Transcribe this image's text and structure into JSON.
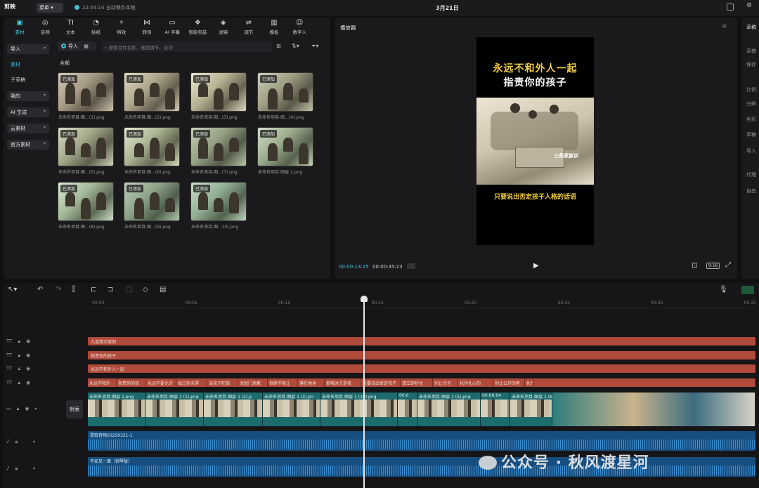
{
  "app": {
    "logo": "剪映",
    "menu": "菜单",
    "save_time": "22:04:14",
    "save_text": "自动保存本地",
    "doc_title": "3月21日"
  },
  "tools": [
    {
      "label": "素材",
      "icon": "media-icon"
    },
    {
      "label": "音频",
      "icon": "audio-icon"
    },
    {
      "label": "文本",
      "icon": "text-icon"
    },
    {
      "label": "贴纸",
      "icon": "sticker-icon"
    },
    {
      "label": "特效",
      "icon": "effects-icon"
    },
    {
      "label": "转场",
      "icon": "transition-icon"
    },
    {
      "label": "AI 字幕",
      "icon": "ai-caption-icon"
    },
    {
      "label": "智能包装",
      "icon": "smart-pack-icon"
    },
    {
      "label": "滤镜",
      "icon": "filter-icon"
    },
    {
      "label": "调节",
      "icon": "adjust-icon"
    },
    {
      "label": "模板",
      "icon": "template-icon"
    },
    {
      "label": "数字人",
      "icon": "avatar-icon"
    }
  ],
  "sidebar": {
    "items": [
      {
        "label": "导入",
        "chevron": true
      },
      {
        "label": "素材",
        "chevron": false
      },
      {
        "label": "子草稿",
        "chevron": false
      },
      {
        "label": "我的",
        "chevron": true
      },
      {
        "label": "AI 生成",
        "chevron": true
      },
      {
        "label": "云素材",
        "chevron": true
      },
      {
        "label": "官方素材",
        "chevron": true
      }
    ]
  },
  "media": {
    "import_label": "导入",
    "search_placeholder": "搜索文件名称、画面情节、台词",
    "all_label": "全部",
    "badge": "已添加",
    "items": [
      "未命名项目-图...(1).png",
      "未命名项目-图...(2).png",
      "未命名项目-图...(3).png",
      "未命名项目-图...(4).png",
      "未命名项目-图...(5).png",
      "未命名项目-图...(6).png",
      "未命名项目-图...(7).png",
      "未命名项目-图层 1.png",
      "未命名项目-图...(8).png",
      "未命名项目-图...(9).png",
      "未命名项目-图...10).png"
    ]
  },
  "player": {
    "title": "播放器",
    "video_line1": "永远不和外人一起",
    "video_line2": "指责你的孩子",
    "video_bottom": "只要说出否定孩子人格的话语",
    "video_watermark": "三条家族训",
    "time_current": "00:00:14:25",
    "time_total": "00:00:35:23",
    "ratio": "9:16"
  },
  "props": {
    "header": "草稿",
    "labels": [
      "草稿",
      "保存",
      "比例",
      "分辨",
      "色彩",
      "草稿",
      "导入",
      "代理",
      "自由"
    ]
  },
  "timeline": {
    "ticks": [
      "00:00",
      "00:05",
      "00:10",
      "00:15",
      "00:20",
      "00:25",
      "00:30",
      "00:35"
    ],
    "cover_label": "封面",
    "text_tracks": [
      "九道清示案例",
      "指责你的孩子",
      "永远不和外人一起"
    ],
    "caption_segments": [
      "永远不和外",
      "指责你的孩",
      "永远不要允许",
      "如过你未得",
      "当孩子犯错",
      "关起门来教",
      "但绝不能让",
      "落在他身",
      "那哦对方是孩",
      "只要说出否定孩子",
      "请立即护住",
      "别让冷言",
      "化作扎心的",
      "别让公开的者",
      "化作"
    ],
    "video_segments": [
      "未命名项目-图层 1.png",
      "未命名项目-图层 1 (1).png",
      "未命名项目-图层 1 (2).p",
      "未命名项目-图层 1 (3).pn",
      "未命名项目-图层 1 (10).png",
      "00:0",
      "未命名项目-图层 1 (5).png",
      "00:00:04",
      "未命名项目-图层 1 (6"
    ],
    "audio_tracks": [
      "提取音频20250321-1",
      "不如见一面（钢琴版）"
    ],
    "watermark": "公众号 · 秋风渡星河"
  },
  "colors": {
    "accent": "#3fc2d6",
    "text_clip": "#b04a3a",
    "video_clip": "#0f5c5f",
    "audio_clip": "#174e80",
    "video_title": "#f5cf3c"
  }
}
